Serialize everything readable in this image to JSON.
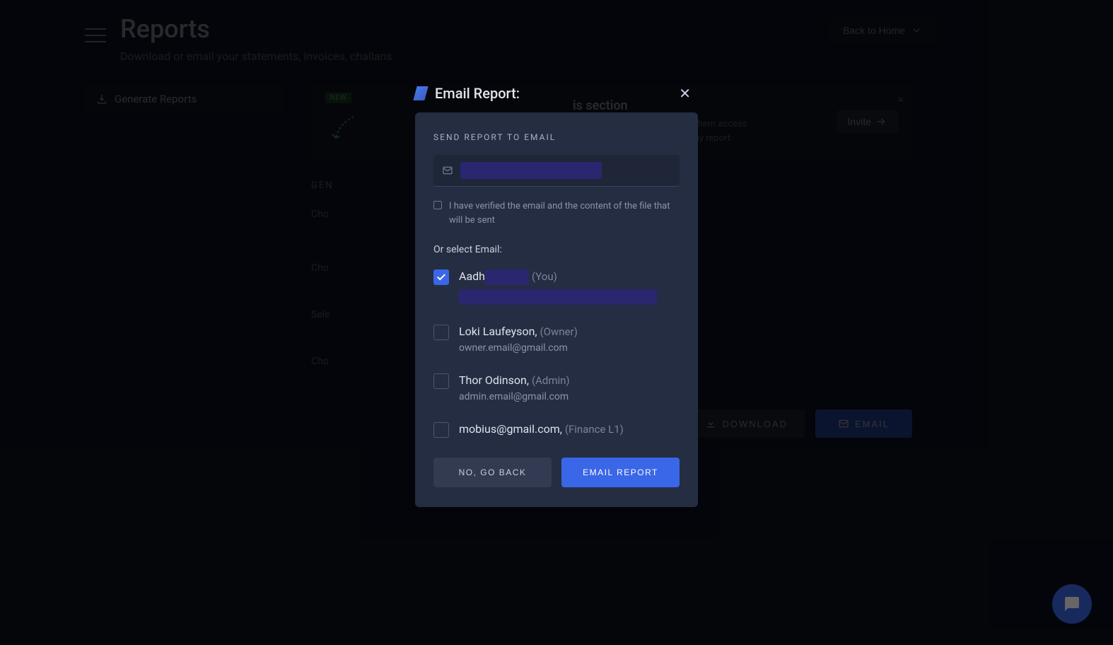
{
  "header": {
    "title": "Reports",
    "subtitle": "Download or email your statements, invoices, challans",
    "back_button": "Back to Home"
  },
  "sidebar": {
    "items": [
      {
        "label": "Generate Reports"
      }
    ]
  },
  "banner": {
    "badge": "NEW",
    "title_partial": "is section",
    "desc_line1": "ication with your CA by giving them access",
    "desc_line2": "m where they can download any report",
    "invite_label": "Invite"
  },
  "form": {
    "heading_prefix": "GEN",
    "label_choose1": "Cho",
    "label_choose2": "Cho",
    "label_select": "Sele",
    "label_choose3": "Cho",
    "download_label": "DOWNLOAD",
    "email_label": "EMAIL"
  },
  "modal": {
    "title": "Email Report:",
    "section_title": "SEND REPORT TO EMAIL",
    "verify_text": "I have verified the email and the content of the file that will be sent",
    "or_select": "Or select Email:",
    "options": [
      {
        "name_prefix": "Aadh",
        "role": "(You)",
        "checked": true,
        "redacted": true
      },
      {
        "name": "Loki Laufeyson,",
        "role": "(Owner)",
        "email": "owner.email@gmail.com",
        "checked": false
      },
      {
        "name": "Thor Odinson,",
        "role": "(Admin)",
        "email": "admin.email@gmail.com",
        "checked": false
      },
      {
        "name": "mobius@gmail.com,",
        "role": "(Finance L1)",
        "checked": false
      }
    ],
    "cancel_label": "NO, GO BACK",
    "confirm_label": "EMAIL REPORT"
  }
}
